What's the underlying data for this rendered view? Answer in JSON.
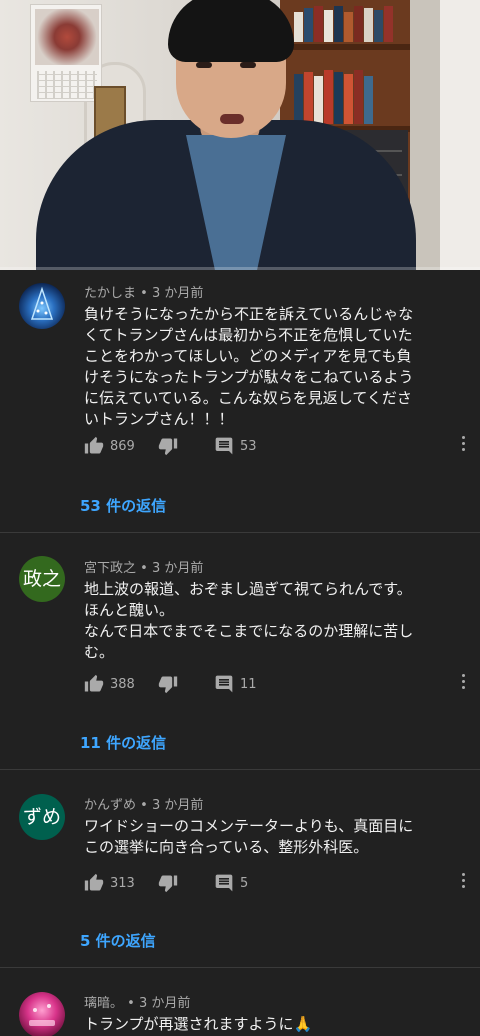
{
  "comments": [
    {
      "author": "たかしま",
      "time": "3 か月前",
      "lines": [
        "負けそうになったから不正を訴えているんじゃな",
        "くてトランプさんは最初から不正を危惧していた",
        "ことをわかってほしい。どのメディアを見ても負",
        "けそうになったトランプが駄々をこねているよう",
        "に伝えていている。こんな奴らを見返してくださ",
        "いトランプさん！！！"
      ],
      "likes": "869",
      "reply_count": "53",
      "replies_label": "53 件の返信"
    },
    {
      "author": "宮下政之",
      "time": "3 か月前",
      "avatar_text": "政之",
      "avatar_color": "#33691e",
      "lines": [
        "地上波の報道、おぞまし過ぎて視てられんです。",
        "ほんと醜い。",
        "なんで日本でまでそこまでになるのか理解に苦し",
        "む。"
      ],
      "likes": "388",
      "reply_count": "11",
      "replies_label": "11 件の返信"
    },
    {
      "author": "かんずめ",
      "time": "3 か月前",
      "avatar_text": "ずめ",
      "avatar_color": "#00604e",
      "lines": [
        "ワイドショーのコメンテーターよりも、真面目に",
        "この選挙に向き合っている、整形外科医。"
      ],
      "likes": "313",
      "reply_count": "5",
      "replies_label": "5 件の返信"
    },
    {
      "author": "璃暗。",
      "time": "3 か月前",
      "lines": [
        "トランプが再選されますように🙏"
      ]
    }
  ],
  "video": {
    "progress": 0
  },
  "colors": {
    "background": "#212121",
    "link": "#3ea6ff",
    "meta": "#aaaaaa"
  },
  "icons": {
    "like": "thumb-up-icon",
    "dislike": "thumb-down-icon",
    "reply": "comment-icon",
    "more": "more-vert-icon"
  }
}
